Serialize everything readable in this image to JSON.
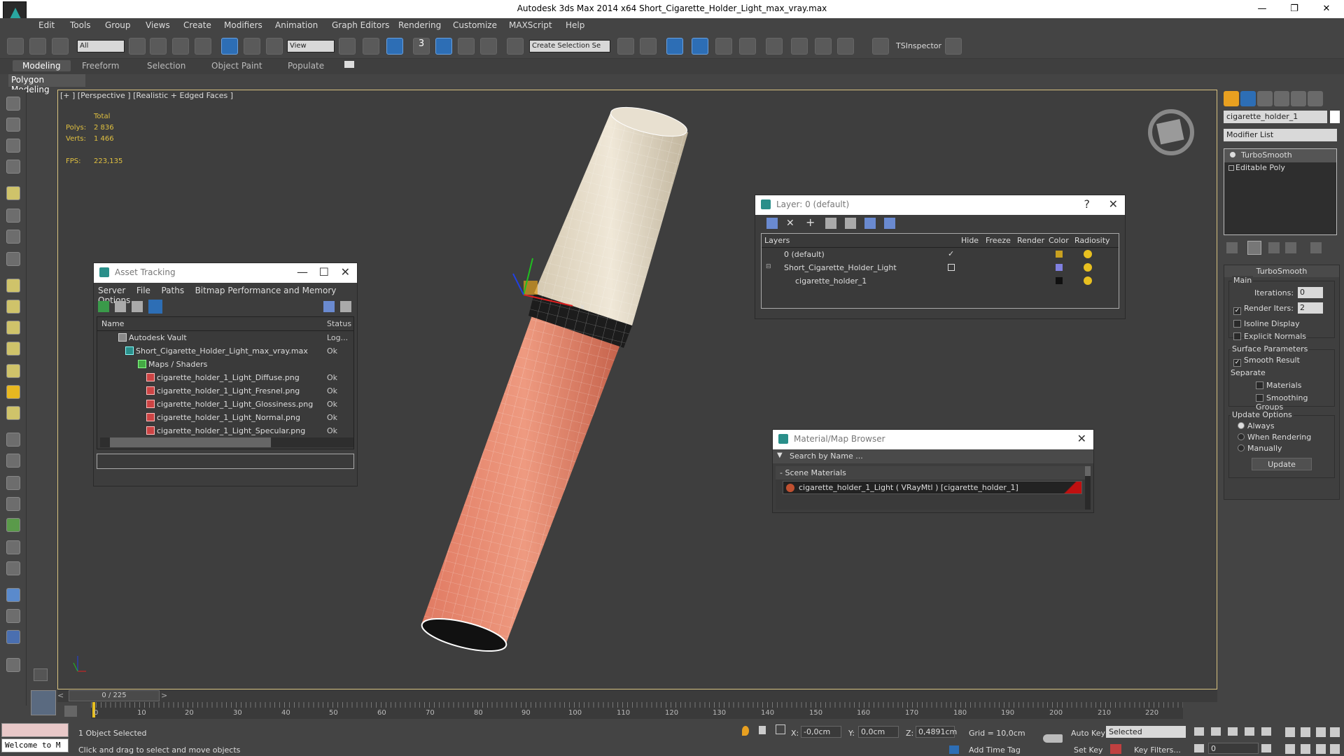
{
  "window": {
    "title": "Autodesk 3ds Max  2014 x64     Short_Cigarette_Holder_Light_max_vray.max",
    "minimize": "—",
    "restore": "❐",
    "close": "✕"
  },
  "menu": [
    "Edit",
    "Tools",
    "Group",
    "Views",
    "Create",
    "Modifiers",
    "Animation",
    "Graph Editors",
    "Rendering",
    "Customize",
    "MAXScript",
    "Help"
  ],
  "toolbar": {
    "filter": "All",
    "refcoord": "View",
    "selset": "Create Selection Se",
    "snap3": "3",
    "tsinspector": "TSInspector"
  },
  "ribbon": {
    "tabs": [
      "Modeling",
      "Freeform",
      "Selection",
      "Object Paint",
      "Populate"
    ],
    "sub": "Polygon Modeling"
  },
  "viewport": {
    "label": "[+ ] [Perspective ] [Realistic + Edged Faces ]",
    "stats": {
      "total": "Total",
      "polys_label": "Polys:",
      "polys": "2 836",
      "verts_label": "Verts:",
      "verts": "1 466",
      "fps_label": "FPS:",
      "fps": "223,135"
    },
    "axis_x": "x"
  },
  "asset_tracking": {
    "title": "Asset Tracking",
    "menu": [
      "Server",
      "File",
      "Paths",
      "Bitmap Performance and Memory",
      "Options"
    ],
    "col_name": "Name",
    "col_status": "Status",
    "rows": [
      {
        "name": "Autodesk Vault",
        "status": "Log..."
      },
      {
        "name": "Short_Cigarette_Holder_Light_max_vray.max",
        "status": "Ok"
      },
      {
        "name": "Maps / Shaders",
        "status": ""
      },
      {
        "name": "cigarette_holder_1_Light_Diffuse.png",
        "status": "Ok"
      },
      {
        "name": "cigarette_holder_1_Light_Fresnel.png",
        "status": "Ok"
      },
      {
        "name": "cigarette_holder_1_Light_Glossiness.png",
        "status": "Ok"
      },
      {
        "name": "cigarette_holder_1_Light_Normal.png",
        "status": "Ok"
      },
      {
        "name": "cigarette_holder_1_Light_Specular.png",
        "status": "Ok"
      }
    ]
  },
  "layer": {
    "title": "Layer: 0 (default)",
    "help": "?",
    "cols": [
      "Layers",
      "Hide",
      "Freeze",
      "Render",
      "Color",
      "Radiosity"
    ],
    "rows": [
      {
        "name": "0 (default)",
        "color": "#c8a020"
      },
      {
        "name": "Short_Cigarette_Holder_Light",
        "color": "#8080e0"
      },
      {
        "name": "cigarette_holder_1",
        "color": "#101010"
      }
    ]
  },
  "material_browser": {
    "title": "Material/Map Browser",
    "search": "Search by Name ...",
    "group": "- Scene Materials",
    "item": "cigarette_holder_1_Light  ( VRayMtl ) [cigarette_holder_1]"
  },
  "command_panel": {
    "object_name": "cigarette_holder_1",
    "modifier_list": "Modifier List",
    "stack": [
      "TurboSmooth",
      "Editable Poly"
    ],
    "rollout_title": "TurboSmooth",
    "main": "Main",
    "iterations_label": "Iterations:",
    "iterations": "0",
    "render_iters_label": "Render Iters:",
    "render_iters": "2",
    "isoline": "Isoline Display",
    "explicit": "Explicit Normals",
    "surface": "Surface Parameters",
    "smooth_result": "Smooth Result",
    "separate": "Separate",
    "materials": "Materials",
    "smoothing_groups": "Smoothing Groups",
    "update_options": "Update Options",
    "always": "Always",
    "when_rendering": "When Rendering",
    "manually": "Manually",
    "update": "Update"
  },
  "timeline": {
    "frame": "0 / 225",
    "ticks": [
      "0",
      "10",
      "20",
      "30",
      "40",
      "50",
      "60",
      "70",
      "80",
      "90",
      "100",
      "110",
      "120",
      "130",
      "140",
      "150",
      "160",
      "170",
      "180",
      "190",
      "200",
      "210",
      "220"
    ]
  },
  "status": {
    "welcome": "Welcome to M",
    "selected": "1 Object Selected",
    "hint": "Click and drag to select and move objects",
    "x_label": "X:",
    "x": "-0,0cm",
    "y_label": "Y:",
    "y": "0,0cm",
    "z_label": "Z:",
    "z": "0,4891cm",
    "grid": "Grid = 10,0cm",
    "add_time_tag": "Add Time Tag",
    "auto_key": "Auto Key",
    "set_key": "Set Key",
    "selected_dd": "Selected",
    "key_filters": "Key Filters...",
    "frame_field": "0"
  }
}
